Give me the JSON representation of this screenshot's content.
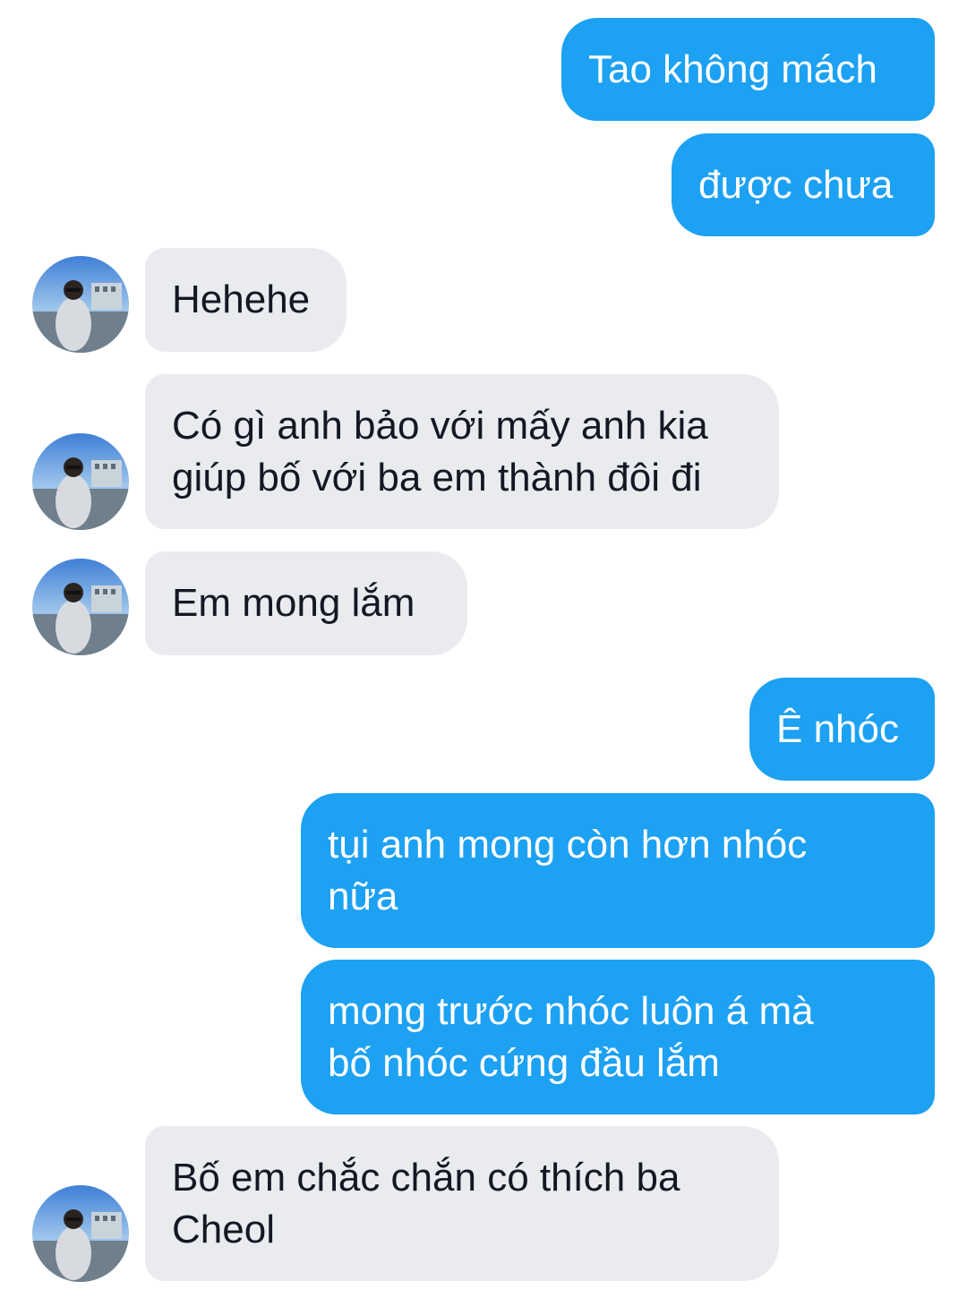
{
  "conversation": {
    "messages": [
      {
        "sender": "me",
        "text": "Tao không mách"
      },
      {
        "sender": "me",
        "text": "được chưa"
      },
      {
        "sender": "contact",
        "text": "Hehehe"
      },
      {
        "sender": "contact",
        "text": "Có gì anh bảo với mấy anh kia\ngiúp bố với ba em thành đôi đi"
      },
      {
        "sender": "contact",
        "text": "Em mong lắm"
      },
      {
        "sender": "me",
        "text": "Ê nhóc"
      },
      {
        "sender": "me",
        "text": "tụi anh mong còn hơn nhóc\nnữa"
      },
      {
        "sender": "me",
        "text": "mong trước nhóc luôn á mà\nbố nhóc cứng đầu lắm"
      },
      {
        "sender": "contact",
        "text": "Bố em chắc chắn có thích ba\nCheol"
      }
    ]
  },
  "colors": {
    "outgoing_bubble": "#1da1f2",
    "incoming_bubble": "#e9ebef",
    "outgoing_text": "#ffffff",
    "incoming_text": "#141823"
  },
  "icons": {
    "avatar": "contact-photo-avatar"
  }
}
